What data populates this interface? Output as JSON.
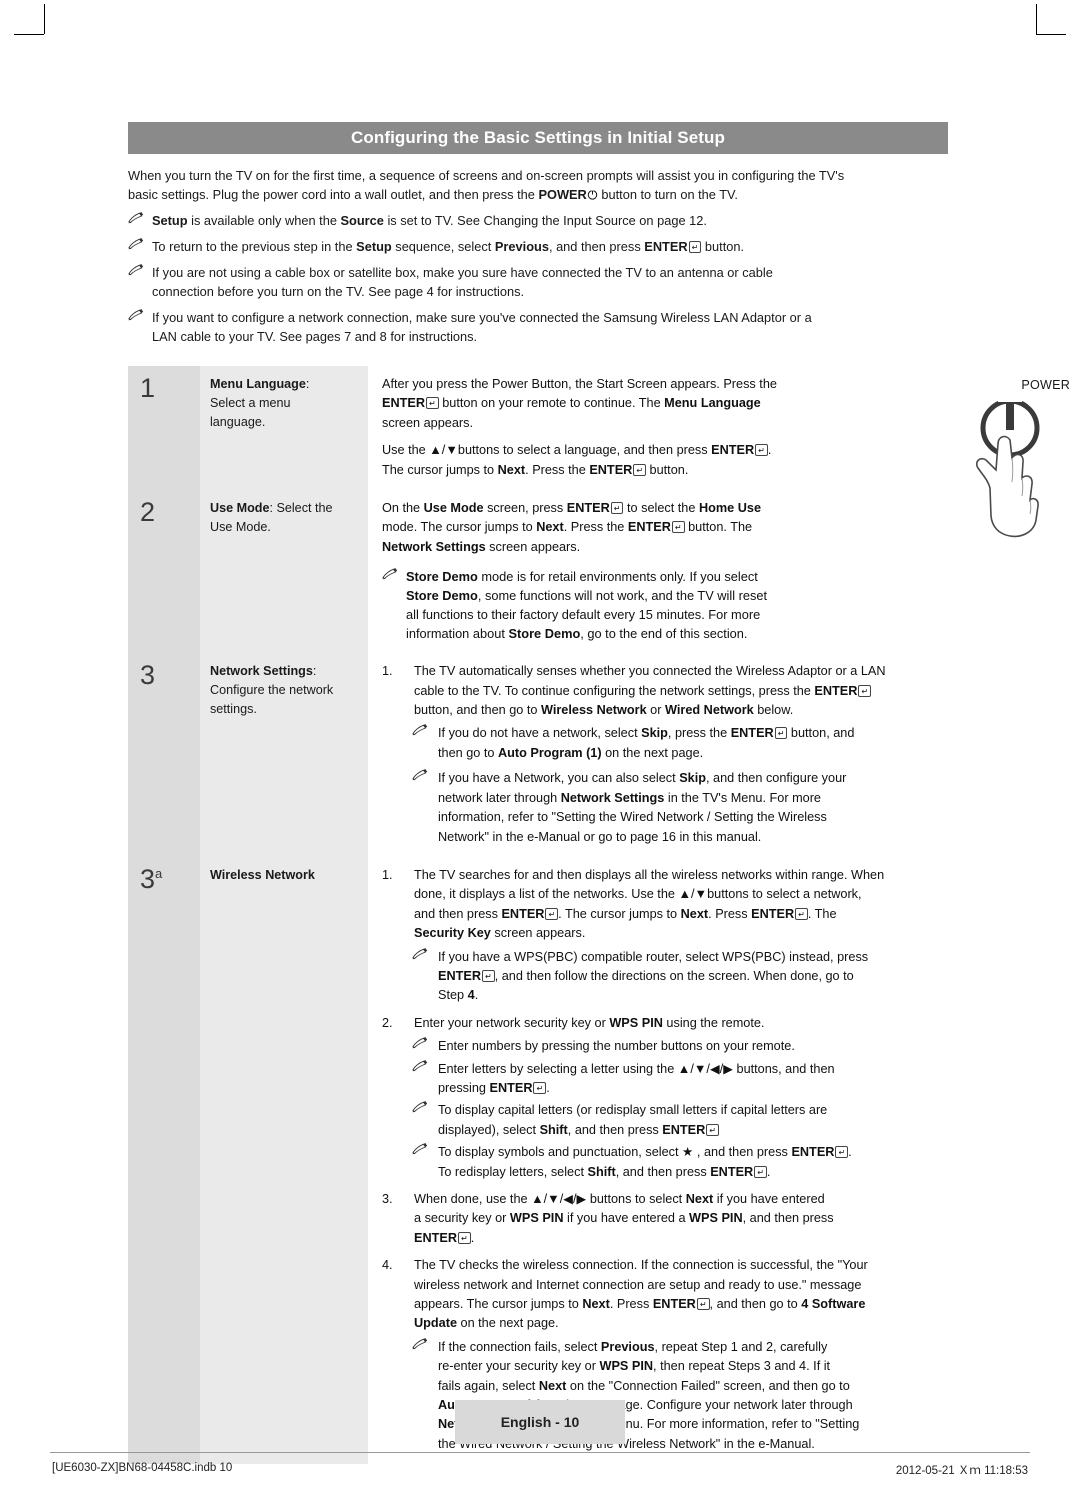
{
  "header": {
    "title": "Configuring the Basic Settings in Initial Setup"
  },
  "intro": {
    "paragraph_1_a": "When you turn the TV on for the first time, a sequence of screens and on-screen prompts will assist you in configuring the TV's",
    "paragraph_1_b": "basic settings. Plug the power cord into a wall outlet, and then press the ",
    "paragraph_1_power": "POWER",
    "paragraph_1_c": " button to turn on the TV.",
    "notes": [
      {
        "line1_pre": "",
        "line1_b1": "Setup",
        "line1_mid": " is available only when the ",
        "line1_b2": "Source",
        "line1_post": " is set to TV. See Changing the Input Source on page 12."
      },
      {
        "text": "To return to the previous step in the Setup sequence, select Previous, and then press ENTER button."
      },
      {
        "line1": "If you are not using a cable box or satellite box, make you sure have connected the TV to an antenna or cable",
        "line2": "connection before you turn on the TV. See page 4 for instructions."
      },
      {
        "line1": "If you want to configure a network connection, make sure you've connected the Samsung Wireless LAN Adaptor or a",
        "line2": "LAN cable to your TV. See pages 7 and 8 for instructions."
      }
    ]
  },
  "power_caption": "POWER",
  "rows": [
    {
      "number": "1",
      "label_bold": "Menu Language",
      "label_rest": ":",
      "label_line2": "Select a menu",
      "label_line3": "language.",
      "body": {
        "p1_a": "After you press the Power Button, the Start Screen appears. Press the",
        "p1_b": "ENTER",
        "p1_c": " button on your remote to continue.  The ",
        "p1_d": "Menu Language",
        "p1_e": "screen appears.",
        "p2_a": "Use the ▲/▼buttons to select a language, and then press ",
        "p2_b": "ENTER",
        "p2_c": ".",
        "p3_a": "The cursor jumps to ",
        "p3_b": "Next",
        "p3_c": ". Press the ",
        "p3_d": "ENTER",
        "p3_e": " button."
      }
    },
    {
      "number": "2",
      "label_bold": "Use Mode",
      "label_rest": ": Select the",
      "label_line2": "Use Mode.",
      "body": {
        "p1_a": "On the ",
        "p1_b": "Use Mode",
        "p1_c": " screen, press ",
        "p1_d": "ENTER",
        "p1_e": " to select the ",
        "p1_f": "Home Use",
        "p2_a": "mode. The cursor jumps to ",
        "p2_b": "Next",
        "p2_c": ". Press the ",
        "p2_d": "ENTER",
        "p2_e": " button. The",
        "p3_a": "Network Settings",
        "p3_b": " screen appears.",
        "note_l1_a": "Store Demo",
        "note_l1_b": " mode is for retail environments only. If you select",
        "note_l2_a": "Store Demo",
        "note_l2_b": ", some functions will not work, and the TV will reset",
        "note_l3": "all functions to their factory default every 15 minutes. For more",
        "note_l4_a": "information about ",
        "note_l4_b": "Store Demo",
        "note_l4_c": ", go to the end of this section."
      }
    },
    {
      "number": "3",
      "label_bold": "Network Settings",
      "label_rest": ":",
      "label_line2": "Configure the network",
      "label_line3": "settings.",
      "body": {
        "i1_n": "1.",
        "i1_l1": "The TV automatically senses whether you connected the Wireless Adaptor or a LAN",
        "i1_l2_a": "cable to the TV. To continue configuring the network settings, press the ",
        "i1_l2_b": "ENTER",
        "i1_l3_a": "button, and then go to ",
        "i1_l3_b": "Wireless Network",
        "i1_l3_c": " or ",
        "i1_l3_d": "Wired Network",
        "i1_l3_e": " below.",
        "n1_l1_a": "If you do not have a network, select ",
        "n1_l1_b": "Skip",
        "n1_l1_c": ", press the ",
        "n1_l1_d": "ENTER",
        "n1_l1_e": " button, and",
        "n1_l2_a": "then go to ",
        "n1_l2_b": "Auto Program (1)",
        "n1_l2_c": " on the next page.",
        "n2_l1_a": "If you have a Network, you can also select ",
        "n2_l1_b": "Skip",
        "n2_l1_c": ", and then configure your",
        "n2_l2_a": "network later through ",
        "n2_l2_b": "Network Settings",
        "n2_l2_c": " in the TV's Menu. For more",
        "n2_l3": "information, refer to \"Setting the Wired Network / Setting the Wireless",
        "n2_l4": "Network\" in the e-Manual or go to page 16 in this manual."
      }
    },
    {
      "number": "3",
      "number_sup": "a",
      "label_bold": "Wireless Network",
      "label_rest": "",
      "body": {
        "i1_n": "1.",
        "i1_l1": "The TV searches for and then displays all the wireless networks within range. When",
        "i1_l2_a": "done, it displays a list of the networks. Use the ▲/▼buttons to select a network,",
        "i1_l3_a": "and then press ",
        "i1_l3_b": "ENTER",
        "i1_l3_c": ". The cursor jumps to ",
        "i1_l3_d": "Next",
        "i1_l3_e": ". Press ",
        "i1_l3_f": "ENTER",
        "i1_l3_g": ".  The",
        "i1_l4_a": "Security Key",
        "i1_l4_b": " screen appears.",
        "n1_l1_a": "If you have a WPS(PBC) compatible router, select WPS(PBC) instead, press",
        "n1_l2_a": "ENTER",
        "n1_l2_b": ", and then follow the directions on the screen. When done, go to",
        "n1_l3_a": "Step ",
        "n1_l3_b": "4",
        "n1_l3_c": ".",
        "i2_n": "2.",
        "i2_l1_a": "Enter your network security key or ",
        "i2_l1_b": "WPS PIN",
        "i2_l1_c": " using the remote.",
        "n2_l1": "Enter numbers by pressing the number buttons on your remote.",
        "n3_l1_a": "Enter letters by selecting a letter using the ▲/▼/◀/▶ buttons, and then",
        "n3_l2_a": "pressing ",
        "n3_l2_b": "ENTER",
        "n3_l2_c": ".",
        "n4_l1_a": "To display capital letters (or redisplay small letters if capital letters are",
        "n4_l2_a": "displayed), select ",
        "n4_l2_b": "Shift",
        "n4_l2_c": ", and then press ",
        "n4_l2_d": "ENTER",
        "n5_l1_a": "To display symbols and punctuation, select  ★ , and then press ",
        "n5_l1_b": "ENTER",
        "n5_l1_c": ".",
        "n5_l2_a": "To redisplay letters, select ",
        "n5_l2_b": "Shift",
        "n5_l2_c": ", and then press ",
        "n5_l2_d": "ENTER",
        "n5_l2_e": ".",
        "i3_n": "3.",
        "i3_l1_a": "When done, use the ▲/▼/◀/▶ buttons to select ",
        "i3_l1_b": "Next",
        "i3_l1_c": " if you have entered",
        "i3_l2_a": "a security key or ",
        "i3_l2_b": "WPS PIN",
        "i3_l2_c": " if you have entered a ",
        "i3_l2_d": "WPS PIN",
        "i3_l2_e": ", and then press",
        "i3_l3_a": "ENTER",
        "i3_l3_b": ".",
        "i4_n": "4.",
        "i4_l1": "The TV checks the wireless connection. If the connection is successful, the \"Your",
        "i4_l2": "wireless network and Internet connection are setup and ready to use.\" message",
        "i4_l3_a": "appears. The cursor jumps to ",
        "i4_l3_b": "Next",
        "i4_l3_c": ". Press ",
        "i4_l3_d": "ENTER",
        "i4_l3_e": ", and then go to ",
        "i4_l3_f": "4 Software",
        "i4_l4_a": "Update",
        "i4_l4_b": " on the next page.",
        "n6_l1_a": "If the connection fails, select ",
        "n6_l1_b": "Previous",
        "n6_l1_c": ", repeat Step 1 and 2, carefully",
        "n6_l2_a": "re-enter your security key or ",
        "n6_l2_b": "WPS PIN",
        "n6_l2_c": ", then repeat Steps 3 and 4.  If it",
        "n6_l3_a": "fails again, select ",
        "n6_l3_b": "Next",
        "n6_l3_c": " on the \"Connection Failed\" screen, and then go to",
        "n6_l4_a": "Auto Program (1)",
        "n6_l4_b": " on the next page. Configure your network later through",
        "n6_l5_a": "Network Settings",
        "n6_l5_b": " in the TV's Menu. For more information, refer to \"Setting",
        "n6_l6": "the Wired Network / Setting the Wireless Network\" in the e-Manual."
      }
    }
  ],
  "footer": {
    "page_tab": "English - 10",
    "left": "[UE6030-ZX]BN68-04458C.indb   10",
    "right": "2012-05-21   Ｘｍ 11:18:53"
  },
  "colors": {
    "header_bg": "#8a8a8a",
    "num_cell_bg": "#dcdcdc",
    "label_cell_bg": "#eaeaea",
    "footer_tab_bg": "#d9d9d9"
  }
}
